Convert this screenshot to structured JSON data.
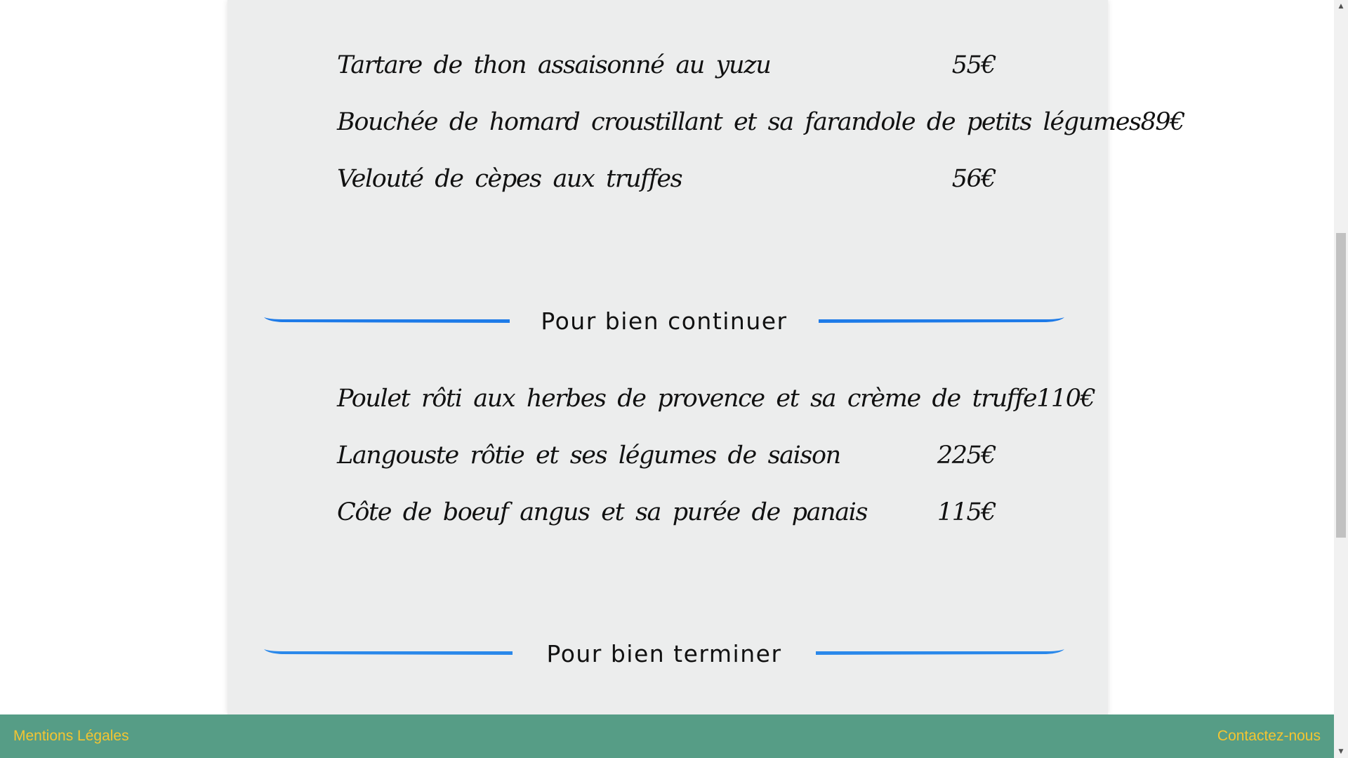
{
  "menu": {
    "starters": [
      {
        "name": "Tartare de thon assaisonné au yuzu",
        "price": "55€"
      },
      {
        "name": "Bouchée de homard croustillant et sa farandole de petits légumes",
        "price": "89€"
      },
      {
        "name": "Velouté de cèpes aux truffes",
        "price": "56€"
      }
    ],
    "sections": {
      "continue_title": "Pour bien continuer",
      "finish_title": "Pour bien terminer"
    },
    "mains": [
      {
        "name": "Poulet rôti aux herbes de provence et sa crème de truffe",
        "price": "110€"
      },
      {
        "name": "Langouste rôtie et ses légumes de saison",
        "price": "225€"
      },
      {
        "name": "Côte de boeuf angus et sa purée de panais",
        "price": "115€"
      }
    ]
  },
  "footer": {
    "legal_link": "Mentions Légales",
    "contact_link": "Contactez-nous"
  },
  "colors": {
    "card_background": "#eceded",
    "divider_blue": "#1e7be8",
    "footer_green": "#569d86",
    "footer_link": "#f4c531"
  },
  "scrollbar": {
    "up_icon": "scroll-up-arrow-icon",
    "down_icon": "scroll-down-arrow-icon",
    "position_fraction": 0.31
  }
}
